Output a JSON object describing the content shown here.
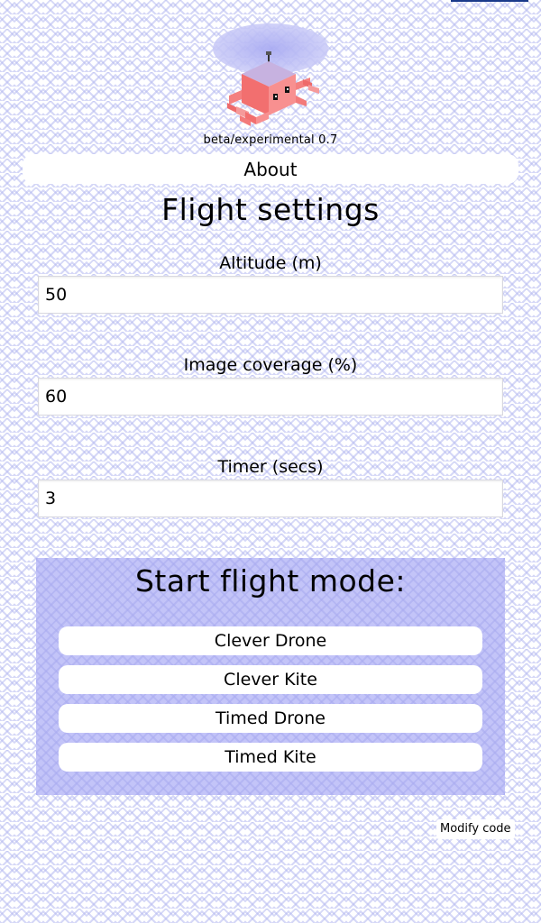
{
  "header": {
    "logo_icon": "robot-octopus-logo-icon",
    "version": "beta/experimental 0.7",
    "about_label": "About"
  },
  "settings": {
    "title": "Flight settings",
    "fields": [
      {
        "label": "Altitude (m)",
        "value": "50"
      },
      {
        "label": "Image coverage (%)",
        "value": "60"
      },
      {
        "label": "Timer (secs)",
        "value": "3"
      }
    ]
  },
  "modes": {
    "title": "Start flight mode:",
    "buttons": [
      "Clever Drone",
      "Clever Kite",
      "Timed Drone",
      "Timed Kite"
    ]
  },
  "footer": {
    "modify_label": "Modify code"
  },
  "colors": {
    "panel": "#c3c4f8",
    "logo_body": "#f47c7c",
    "logo_halo": "#b9b9f5"
  }
}
